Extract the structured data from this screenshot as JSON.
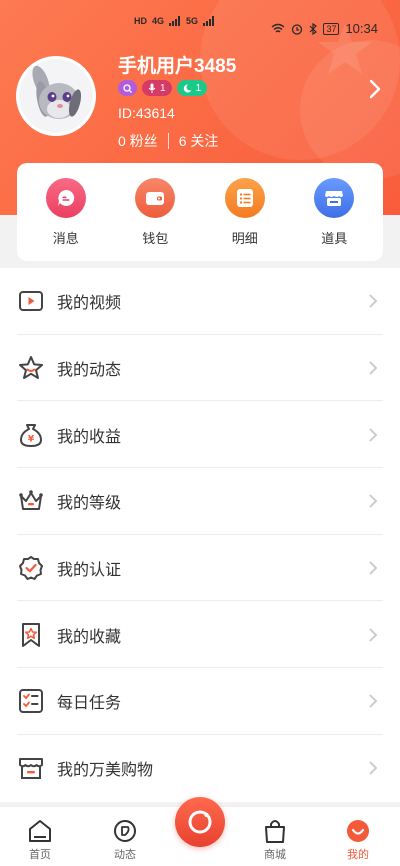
{
  "status": {
    "left_indicators": [
      "HD",
      "4G",
      "5G"
    ],
    "battery": "37",
    "time": "10:34"
  },
  "profile": {
    "username": "手机用户3485",
    "user_id": "ID:43614",
    "fans": "0 粉丝",
    "following": "6 关注",
    "badges": [
      {
        "icon": "search-badge-icon",
        "text": ""
      },
      {
        "icon": "mic-icon",
        "text": "1"
      },
      {
        "icon": "moon-icon",
        "text": "1"
      }
    ]
  },
  "quick_actions": [
    {
      "label": "消息",
      "icon": "message-icon",
      "color": "#f0506f"
    },
    {
      "label": "钱包",
      "icon": "wallet-icon",
      "color": "#f2704c"
    },
    {
      "label": "明细",
      "icon": "list-detail-icon",
      "color": "#f68a2e"
    },
    {
      "label": "道具",
      "icon": "store-icon",
      "color": "#4a82f0"
    }
  ],
  "menu": [
    {
      "label": "我的视频",
      "icon": "video-icon"
    },
    {
      "label": "我的动态",
      "icon": "star-icon"
    },
    {
      "label": "我的收益",
      "icon": "money-bag-icon"
    },
    {
      "label": "我的等级",
      "icon": "crown-icon"
    },
    {
      "label": "我的认证",
      "icon": "certified-badge-icon"
    },
    {
      "label": "我的收藏",
      "icon": "bookmark-icon"
    },
    {
      "label": "每日任务",
      "icon": "task-list-icon"
    },
    {
      "label": "我的万美购物",
      "icon": "shop-icon"
    }
  ],
  "tabs": [
    {
      "label": "首页",
      "icon": "home-icon",
      "active": false
    },
    {
      "label": "动态",
      "icon": "moments-icon",
      "active": false
    },
    {
      "label": "商城",
      "icon": "shopping-bag-icon",
      "active": false
    },
    {
      "label": "我的",
      "icon": "profile-smile-icon",
      "active": true
    }
  ],
  "colors": {
    "accent": "#f95c3c",
    "active_tab": "#f45a3a"
  }
}
